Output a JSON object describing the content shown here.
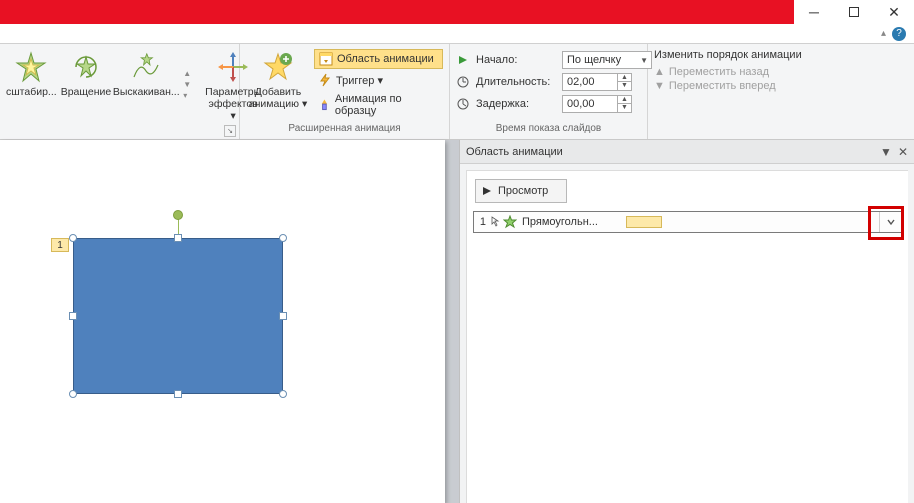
{
  "window": {
    "help_symbol": "?",
    "collapse_symbol": "▴"
  },
  "ribbon": {
    "gallery": {
      "items": [
        {
          "label": "сштабир..."
        },
        {
          "label": "Вращение"
        },
        {
          "label": "Выскакиван..."
        }
      ]
    },
    "effect_options": {
      "label_l1": "Параметры",
      "label_l2": "эффектов ▾"
    },
    "add_anim": {
      "label_l1": "Добавить",
      "label_l2": "анимацию ▾"
    },
    "advanced": {
      "pane_btn": "Область анимации",
      "trigger_btn": "Триггер ▾",
      "painter_btn": "Анимация по образцу",
      "group_label": "Расширенная анимация"
    },
    "timing": {
      "start_label": "Начало:",
      "start_value": "По щелчку",
      "duration_label": "Длительность:",
      "duration_value": "02,00",
      "delay_label": "Задержка:",
      "delay_value": "00,00",
      "group_label": "Время показа слайдов"
    },
    "reorder": {
      "title": "Изменить порядок анимации",
      "back": "Переместить назад",
      "forward": "Переместить вперед"
    }
  },
  "slide": {
    "anim_tag": "1"
  },
  "pane": {
    "title": "Область анимации",
    "preview": "Просмотр",
    "item": {
      "index": "1",
      "name": "Прямоугольн..."
    }
  }
}
